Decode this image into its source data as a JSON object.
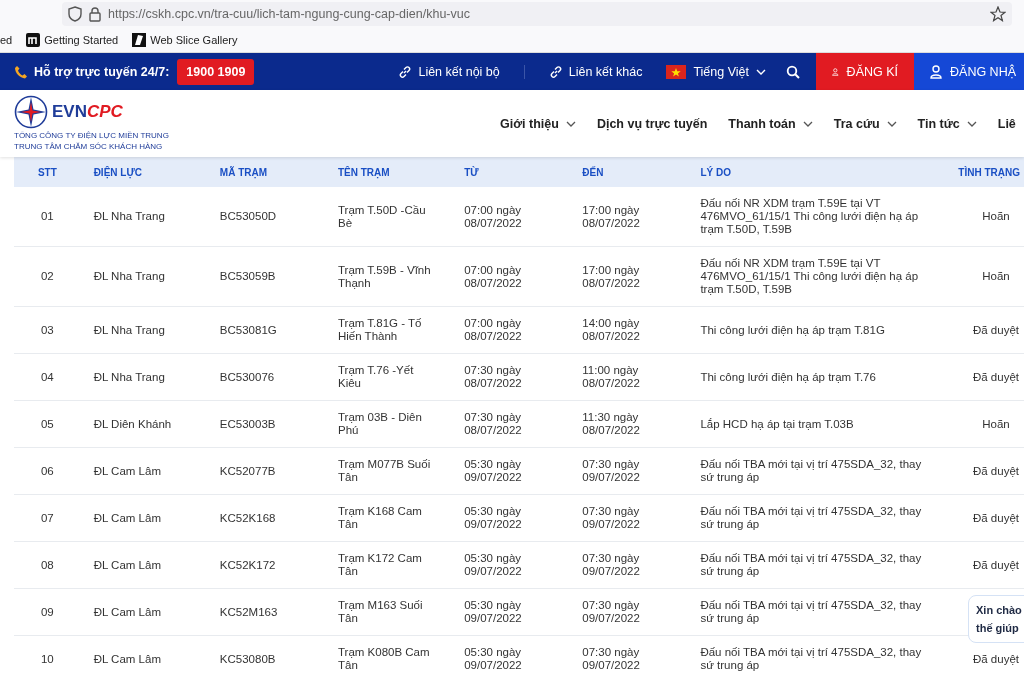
{
  "browser": {
    "url": "https://cskh.cpc.vn/tra-cuu/lich-tam-ngung-cung-cap-dien/khu-vuc",
    "bookmarks": [
      {
        "label": "ed",
        "kind": "plain"
      },
      {
        "label": "Getting Started",
        "kind": "logo"
      },
      {
        "label": "Web Slice Gallery",
        "kind": "slice"
      }
    ]
  },
  "topbar": {
    "support_label": "Hỗ trợ trực tuyến 24/7:",
    "hotline": "1900 1909",
    "links": [
      "Liên kết nội bộ",
      "Liên kết khác"
    ],
    "language": "Tiếng Việt",
    "register": "ĐĂNG KÍ",
    "login": "ĐĂNG NHẬ"
  },
  "header": {
    "logo": {
      "text_a": "EVN",
      "text_b": "CPC",
      "line_1": "TỔNG CÔNG TY ĐIỆN LỰC MIỀN TRUNG",
      "line_2": "TRUNG TÂM CHĂM SÓC KHÁCH HÀNG"
    },
    "nav": [
      {
        "label": "Giới thiệu",
        "dropdown": true
      },
      {
        "label": "Dịch vụ trực tuyến",
        "dropdown": false
      },
      {
        "label": "Thanh toán",
        "dropdown": true
      },
      {
        "label": "Tra cứu",
        "dropdown": true
      },
      {
        "label": "Tin tức",
        "dropdown": true
      },
      {
        "label": "Liê",
        "dropdown": false
      }
    ]
  },
  "table": {
    "columns": [
      "STT",
      "ĐIỆN LỰC",
      "MÃ TRẠM",
      "TÊN TRẠM",
      "TỪ",
      "ĐẾN",
      "LÝ DO",
      "TÌNH TRẠNG"
    ],
    "rows": [
      {
        "stt": "01",
        "unit": "ĐL Nha Trang",
        "code": "BC53050D",
        "station": "Trạm T.50D -Cầu Bè",
        "from": "07:00 ngày 08/07/2022",
        "to": "17:00 ngày 08/07/2022",
        "reason": "Đấu nối NR XDM trạm T.59E tại VT 476MVO_61/15/1 Thi công lưới điện hạ áp trạm T.50D, T.59B",
        "status": "Hoãn"
      },
      {
        "stt": "02",
        "unit": "ĐL Nha Trang",
        "code": "BC53059B",
        "station": "Trạm T.59B - Vĩnh Thạnh",
        "from": "07:00 ngày 08/07/2022",
        "to": "17:00 ngày 08/07/2022",
        "reason": "Đấu nối NR XDM trạm T.59E tại VT 476MVO_61/15/1 Thi công lưới điện hạ áp trạm T.50D, T.59B",
        "status": "Hoãn"
      },
      {
        "stt": "03",
        "unit": "ĐL Nha Trang",
        "code": "BC53081G",
        "station": "Trạm T.81G - Tố Hiến Thành",
        "from": "07:00 ngày 08/07/2022",
        "to": "14:00 ngày 08/07/2022",
        "reason": "Thi công lưới điện hạ áp trạm T.81G",
        "status": "Đã duyệt"
      },
      {
        "stt": "04",
        "unit": "ĐL Nha Trang",
        "code": "BC530076",
        "station": "Trạm T.76 -Yết Kiêu",
        "from": "07:30 ngày 08/07/2022",
        "to": "11:00 ngày 08/07/2022",
        "reason": "Thi công lưới điện hạ áp trạm T.76",
        "status": "Đã duyệt"
      },
      {
        "stt": "05",
        "unit": "ĐL Diên Khánh",
        "code": "EC53003B",
        "station": "Trạm 03B - Diên Phú",
        "from": "07:30 ngày 08/07/2022",
        "to": "11:30 ngày 08/07/2022",
        "reason": "Lắp HCD hạ áp tại trạm T.03B",
        "status": "Hoãn"
      },
      {
        "stt": "06",
        "unit": "ĐL Cam Lâm",
        "code": "KC52077B",
        "station": "Trạm M077B Suối Tân",
        "from": "05:30 ngày 09/07/2022",
        "to": "07:30 ngày 09/07/2022",
        "reason": "Đấu nối TBA mới tại vị trí 475SDA_32, thay sứ trung áp",
        "status": "Đã duyệt"
      },
      {
        "stt": "07",
        "unit": "ĐL Cam Lâm",
        "code": "KC52K168",
        "station": "Trạm K168 Cam Tân",
        "from": "05:30 ngày 09/07/2022",
        "to": "07:30 ngày 09/07/2022",
        "reason": "Đấu nối TBA mới tại vị trí 475SDA_32, thay sứ trung áp",
        "status": "Đã duyệt"
      },
      {
        "stt": "08",
        "unit": "ĐL Cam Lâm",
        "code": "KC52K172",
        "station": "Trạm K172 Cam Tân",
        "from": "05:30 ngày 09/07/2022",
        "to": "07:30 ngày 09/07/2022",
        "reason": "Đấu nối TBA mới tại vị trí 475SDA_32, thay sứ trung áp",
        "status": "Đã duyệt"
      },
      {
        "stt": "09",
        "unit": "ĐL Cam Lâm",
        "code": "KC52M163",
        "station": "Trạm M163 Suối Tân",
        "from": "05:30 ngày 09/07/2022",
        "to": "07:30 ngày 09/07/2022",
        "reason": "Đấu nối TBA mới tại vị trí 475SDA_32, thay sứ trung áp"
      },
      {
        "stt": "10",
        "unit": "ĐL Cam Lâm",
        "code": "KC53080B",
        "station": "Trạm K080B Cam Tân",
        "from": "05:30 ngày 09/07/2022",
        "to": "07:30 ngày 09/07/2022",
        "reason": "Đấu nối TBA mới tại vị trí 475SDA_32, thay sứ trung áp",
        "status": "Đã duyệt"
      }
    ]
  },
  "chat_bubble": {
    "lines": [
      "Xin chào",
      "thế giúp"
    ]
  }
}
